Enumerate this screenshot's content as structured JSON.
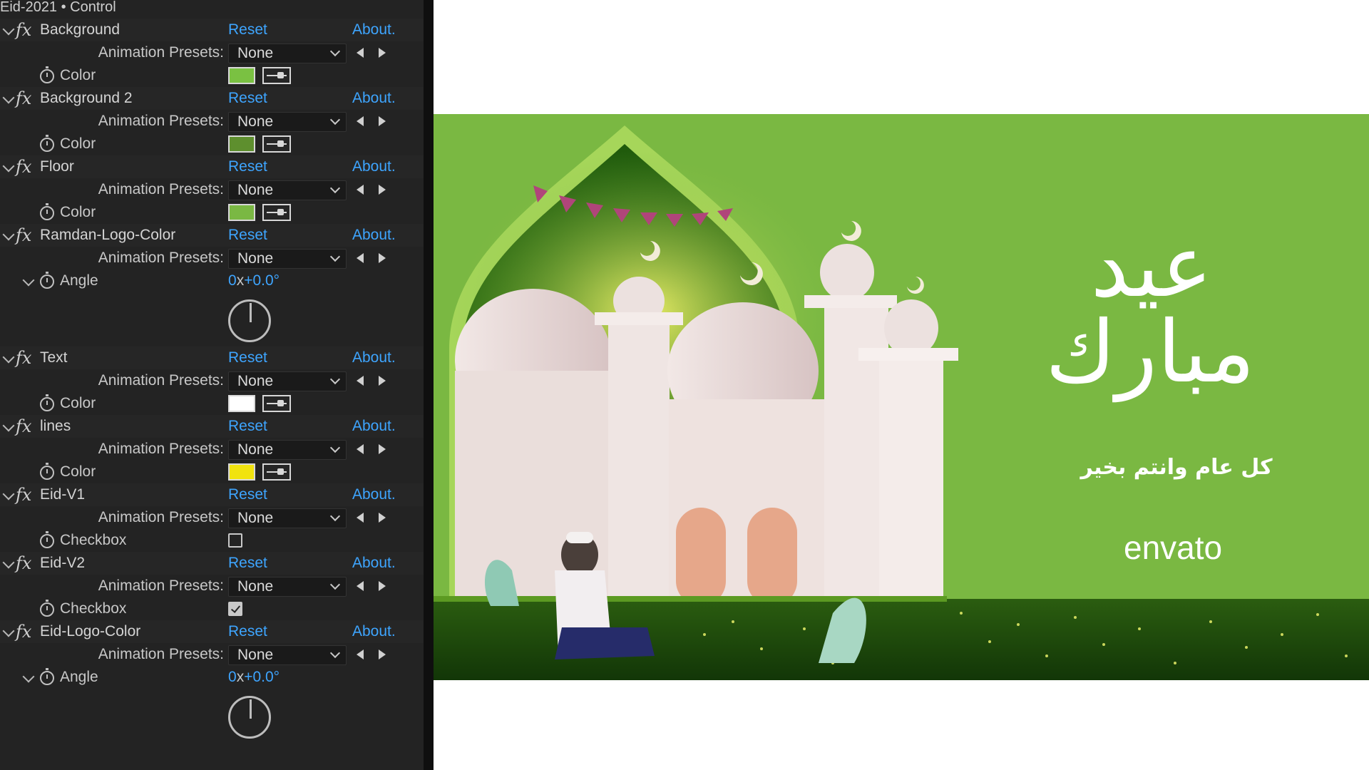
{
  "panel": {
    "title": "Eid-2021 • Control",
    "fx_symbol": "fx",
    "effects": [
      {
        "name": "Background",
        "reset": "Reset",
        "about": "About.",
        "preset_label": "Animation Presets:",
        "preset_value": "None",
        "props": [
          {
            "kind": "color",
            "label": "Color",
            "color": "#7ac142"
          }
        ]
      },
      {
        "name": "Background 2",
        "reset": "Reset",
        "about": "About.",
        "preset_label": "Animation Presets:",
        "preset_value": "None",
        "props": [
          {
            "kind": "color",
            "label": "Color",
            "color": "#5e8f2e"
          }
        ]
      },
      {
        "name": "Floor",
        "reset": "Reset",
        "about": "About.",
        "preset_label": "Animation Presets:",
        "preset_value": "None",
        "props": [
          {
            "kind": "color",
            "label": "Color",
            "color": "#7ab843"
          }
        ]
      },
      {
        "name": "Ramdan-Logo-Color",
        "reset": "Reset",
        "about": "About.",
        "preset_label": "Animation Presets:",
        "preset_value": "None",
        "props": [
          {
            "kind": "angle",
            "label": "Angle",
            "value_turns": "0",
            "value_x": "x",
            "value_deg": "+0.0°"
          }
        ]
      },
      {
        "name": "Text",
        "reset": "Reset",
        "about": "About.",
        "preset_label": "Animation Presets:",
        "preset_value": "None",
        "props": [
          {
            "kind": "color",
            "label": "Color",
            "color": "#ffffff"
          }
        ]
      },
      {
        "name": "lines",
        "reset": "Reset",
        "about": "About.",
        "preset_label": "Animation Presets:",
        "preset_value": "None",
        "props": [
          {
            "kind": "color",
            "label": "Color",
            "color": "#f1e30f"
          }
        ]
      },
      {
        "name": "Eid-V1",
        "reset": "Reset",
        "about": "About.",
        "preset_label": "Animation Presets:",
        "preset_value": "None",
        "props": [
          {
            "kind": "checkbox",
            "label": "Checkbox",
            "checked": false
          }
        ]
      },
      {
        "name": "Eid-V2",
        "reset": "Reset",
        "about": "About.",
        "preset_label": "Animation Presets:",
        "preset_value": "None",
        "props": [
          {
            "kind": "checkbox",
            "label": "Checkbox",
            "checked": true
          }
        ]
      },
      {
        "name": "Eid-Logo-Color",
        "reset": "Reset",
        "about": "About.",
        "preset_label": "Animation Presets:",
        "preset_value": "None",
        "props": [
          {
            "kind": "angle",
            "label": "Angle",
            "value_turns": "0",
            "value_x": "x",
            "value_deg": "+0.0°"
          }
        ]
      }
    ]
  },
  "preview": {
    "calligraphy": "عيد مبارك",
    "greeting": "كل عام وانتم بخير",
    "logo": "envato",
    "colors": {
      "background": "#7ab842",
      "arch_inner": "#3d7a12",
      "floor": "#1f4d0c",
      "mosque": "#efe4e0",
      "glow": "#e8f05a"
    }
  }
}
